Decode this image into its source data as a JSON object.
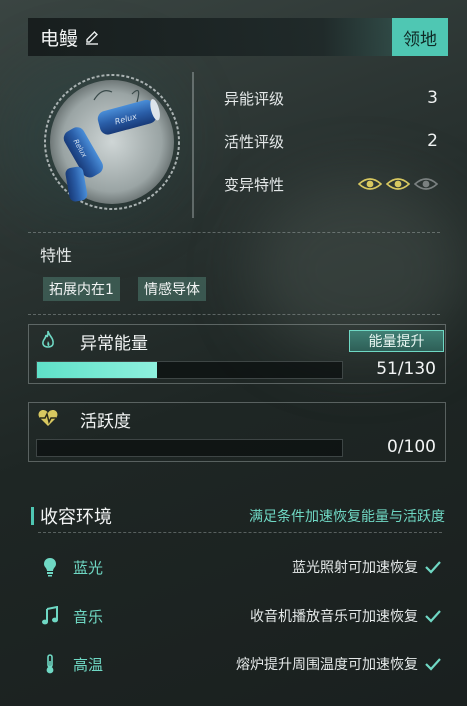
{
  "header": {
    "name": "电鳗",
    "territory_label": "领地"
  },
  "stats": [
    {
      "label": "异能评级",
      "value": "3"
    },
    {
      "label": "活性评级",
      "value": "2"
    },
    {
      "label": "变异特性",
      "value": ""
    }
  ],
  "mutation_eyes": {
    "active": 2,
    "total": 3
  },
  "traits": {
    "title": "特性",
    "tags": [
      "拓展内在1",
      "情感导体"
    ]
  },
  "energy": {
    "title": "异常能量",
    "boost_label": "能量提升",
    "current": 51,
    "max": 130,
    "display": "51/130"
  },
  "activity": {
    "title": "活跃度",
    "current": 0,
    "max": 100,
    "display": "0/100"
  },
  "environment": {
    "title": "收容环境",
    "description": "满足条件加速恢复能量与活跃度",
    "items": [
      {
        "name": "蓝光",
        "desc": "蓝光照射可加速恢复",
        "icon": "lightbulb-icon"
      },
      {
        "name": "音乐",
        "desc": "收音机播放音乐可加速恢复",
        "icon": "music-note-icon"
      },
      {
        "name": "高温",
        "desc": "熔炉提升周围温度可加速恢复",
        "icon": "thermometer-icon"
      }
    ]
  },
  "colors": {
    "accent": "#4fc7b3",
    "accent_text": "#6fd8c4",
    "bar_fill": "#5fe0c8",
    "eye_active": "#d8c860"
  }
}
